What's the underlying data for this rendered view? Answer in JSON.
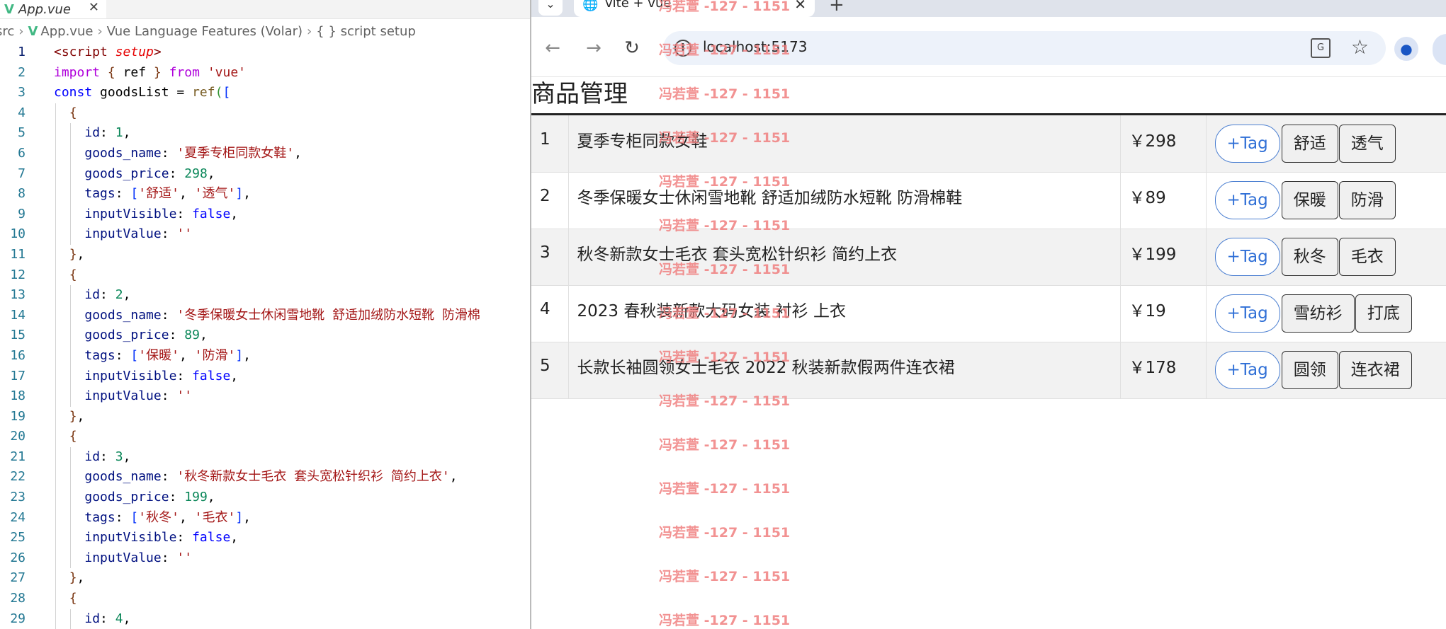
{
  "editor": {
    "tab": {
      "filename": "App.vue"
    },
    "breadcrumb": [
      "src",
      "App.vue",
      "Vue Language Features (Volar)",
      "{ } script setup"
    ],
    "active_line": 1
  },
  "browser": {
    "tab_title": "vite + vue",
    "url": "localhost:5173"
  },
  "page": {
    "title": "商品管理",
    "add_tag_label": "+Tag",
    "goods": [
      {
        "id": "1",
        "name": "夏季专柜同款女鞋",
        "price": "￥298",
        "tags": [
          "舒适",
          "透气"
        ]
      },
      {
        "id": "2",
        "name": "冬季保暖女士休闲雪地靴 舒适加绒防水短靴 防滑棉鞋",
        "price": "￥89",
        "tags": [
          "保暖",
          "防滑"
        ]
      },
      {
        "id": "3",
        "name": "秋冬新款女士毛衣 套头宽松针织衫 简约上衣",
        "price": "￥199",
        "tags": [
          "秋冬",
          "毛衣"
        ]
      },
      {
        "id": "4",
        "name": "2023 春秋装新款大码女装 衬衫 上衣",
        "price": "￥19",
        "tags": [
          "雪纺衫",
          "打底"
        ]
      },
      {
        "id": "5",
        "name": "长款长袖圆领女士毛衣 2022 秋装新款假两件连衣裙",
        "price": "￥178",
        "tags": [
          "圆领",
          "连衣裙"
        ]
      }
    ]
  },
  "watermark": "冯若萱 -127 - 1151",
  "code_lines": [
    "<script setup>",
    "import { ref } from 'vue'",
    "const goodsList = ref([",
    "  {",
    "    id: 1,",
    "    goods_name: '夏季专柜同款女鞋',",
    "    goods_price: 298,",
    "    tags: ['舒适', '透气'],",
    "    inputVisible: false,",
    "    inputValue: ''",
    "  },",
    "  {",
    "    id: 2,",
    "    goods_name: '冬季保暖女士休闲雪地靴 舒适加绒防水短靴 防滑棉",
    "    goods_price: 89,",
    "    tags: ['保暖', '防滑'],",
    "    inputVisible: false,",
    "    inputValue: ''",
    "  },",
    "  {",
    "    id: 3,",
    "    goods_name: '秋冬新款女士毛衣 套头宽松针织衫 简约上衣',",
    "    goods_price: 199,",
    "    tags: ['秋冬', '毛衣'],",
    "    inputVisible: false,",
    "    inputValue: ''",
    "  },",
    "  {",
    "    id: 4,"
  ]
}
